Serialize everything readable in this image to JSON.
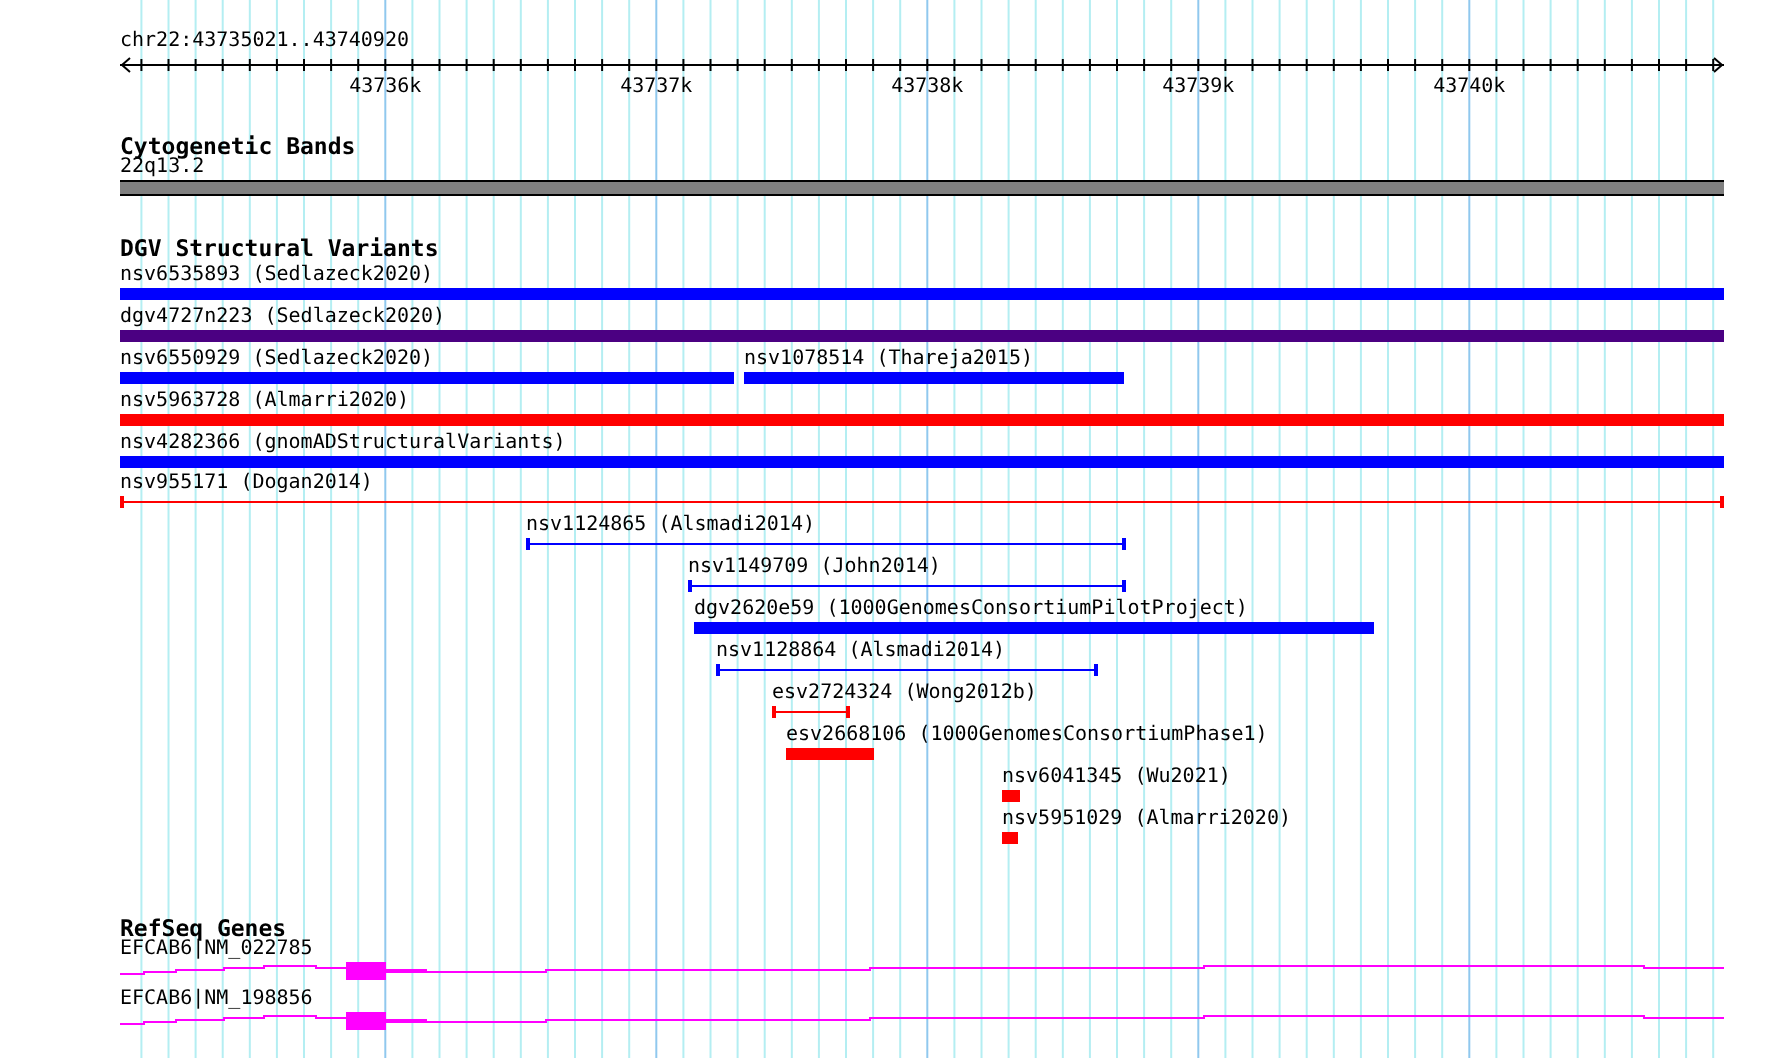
{
  "ruler": {
    "region": "chr22:43735021..43740920",
    "labels": [
      "43736k",
      "43737k",
      "43738k",
      "43739k",
      "43740k"
    ]
  },
  "tracks": [
    {
      "kind": "bands",
      "title": "Cytogenetic Bands",
      "band": {
        "label": "22q13.2",
        "color": "#808080"
      }
    },
    {
      "kind": "variants",
      "title": "DGV Structural Variants",
      "rows": [
        {
          "features": [
            {
              "label": "nsv6535893 (Sedlazeck2020)",
              "color": "#0000ff",
              "kind": "block"
            }
          ]
        },
        {
          "features": [
            {
              "label": "dgv4727n223 (Sedlazeck2020)",
              "color": "#4b0082",
              "kind": "block"
            }
          ]
        },
        {
          "features": [
            {
              "label": "nsv6550929 (Sedlazeck2020)",
              "color": "#0000ff",
              "kind": "block"
            },
            {
              "label": "nsv1078514 (Thareja2015)",
              "color": "#0000ff",
              "kind": "block"
            }
          ]
        },
        {
          "features": [
            {
              "label": "nsv5963728 (Almarri2020)",
              "color": "#ff0000",
              "kind": "block"
            }
          ]
        },
        {
          "features": [
            {
              "label": "nsv4282366 (gnomADStructuralVariants)",
              "color": "#0000ff",
              "kind": "block"
            }
          ]
        },
        {
          "features": [
            {
              "label": "nsv955171 (Dogan2014)",
              "color": "#ff0000",
              "kind": "interval"
            }
          ]
        },
        {
          "features": [
            {
              "label": "nsv1124865 (Alsmadi2014)",
              "color": "#0000ff",
              "kind": "interval"
            }
          ]
        },
        {
          "features": [
            {
              "label": "nsv1149709 (John2014)",
              "color": "#0000ff",
              "kind": "interval"
            }
          ]
        },
        {
          "features": [
            {
              "label": "dgv2620e59 (1000GenomesConsortiumPilotProject)",
              "color": "#0000ff",
              "kind": "block"
            }
          ]
        },
        {
          "features": [
            {
              "label": "nsv1128864 (Alsmadi2014)",
              "color": "#0000ff",
              "kind": "interval"
            }
          ]
        },
        {
          "features": [
            {
              "label": "esv2724324 (Wong2012b)",
              "color": "#ff0000",
              "kind": "interval"
            }
          ]
        },
        {
          "features": [
            {
              "label": "esv2668106 (1000GenomesConsortiumPhase1)",
              "color": "#ff0000",
              "kind": "block"
            }
          ]
        },
        {
          "features": [
            {
              "label": "nsv6041345 (Wu2021)",
              "color": "#ff0000",
              "kind": "block"
            }
          ]
        },
        {
          "features": [
            {
              "label": "nsv5951029 (Almarri2020)",
              "color": "#ff0000",
              "kind": "block"
            }
          ]
        }
      ]
    },
    {
      "kind": "genes",
      "title": "RefSeq Genes",
      "genes": [
        {
          "label": "EFCAB6|NM_022785",
          "color": "#ff00ff"
        },
        {
          "label": "EFCAB6|NM_198856",
          "color": "#ff00ff"
        }
      ]
    }
  ]
}
